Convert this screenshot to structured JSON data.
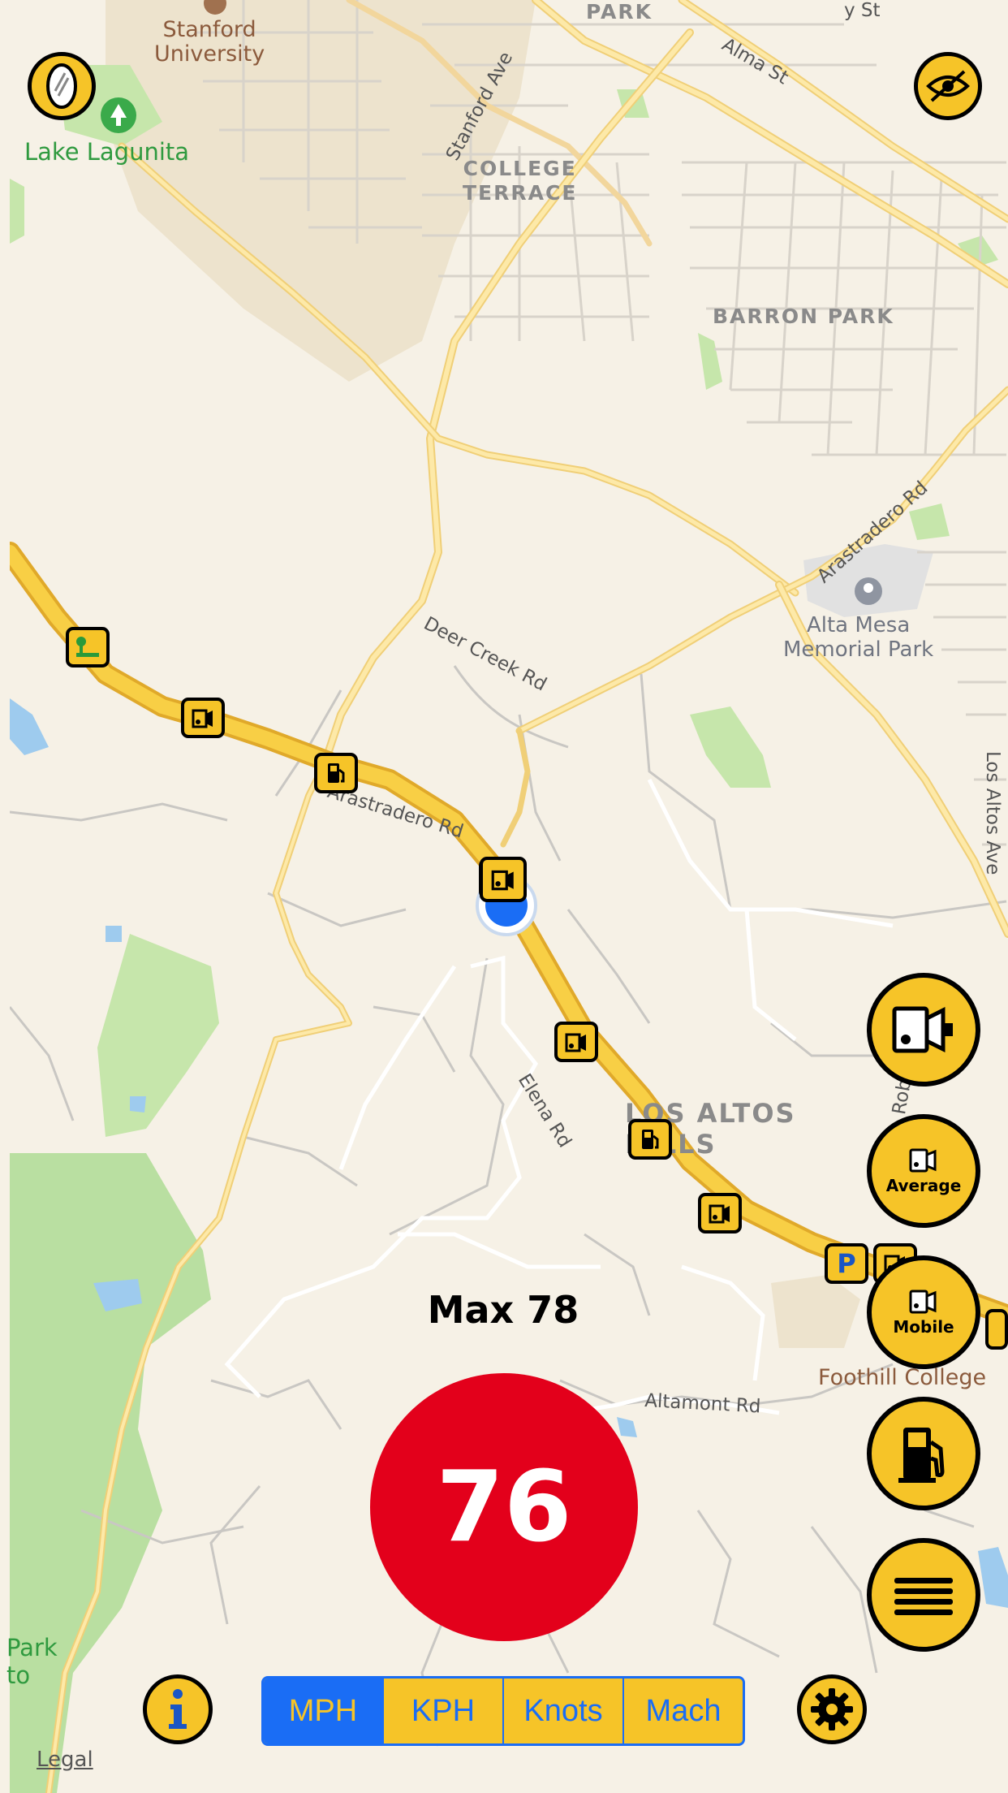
{
  "map": {
    "labels": {
      "stanford": "Stanford\nUniversity",
      "lake_lagunita": "Lake Lagunita",
      "park_top": "PARK",
      "alma_st": "Alma St",
      "stanford_ave": "Stanford Ave",
      "college_terrace": "COLLEGE\nTERRACE",
      "barron_park": "BARRON PARK",
      "arastradero_rd_ne": "Arastradero Rd",
      "alta_mesa": "Alta Mesa\nMemorial Park",
      "deer_creek_rd": "Deer Creek Rd",
      "arastradero_rd": "Arastradero Rd",
      "los_altos_ave": "Los Altos Ave",
      "elena_rd": "Elena Rd",
      "los_altos_hills": "LOS ALTOS\nHILLS",
      "foothill_college": "Foothill College",
      "altamont_rd": "Altamont Rd",
      "park_bottom": "Park\nto",
      "rob": "Rob",
      "top_st": "y St"
    },
    "legal": "Legal"
  },
  "speed": {
    "current": "76",
    "max_label": "Max 78"
  },
  "right_buttons": {
    "fixed_camera": "fixed-camera",
    "average_label": "Average",
    "mobile_label": "Mobile",
    "fuel": "fuel",
    "menu": "menu"
  },
  "units": {
    "options": [
      "MPH",
      "KPH",
      "Knots",
      "Mach"
    ],
    "selected": "MPH"
  },
  "colors": {
    "accent_yellow": "#f6c428",
    "speed_red": "#e3001b",
    "segment_blue": "#1a6df5",
    "map_bg": "#f6f1e6"
  },
  "icons": {
    "top_left": "mirror-icon",
    "top_right": "eye-off-icon",
    "info": "info-icon",
    "settings": "gear-icon"
  }
}
